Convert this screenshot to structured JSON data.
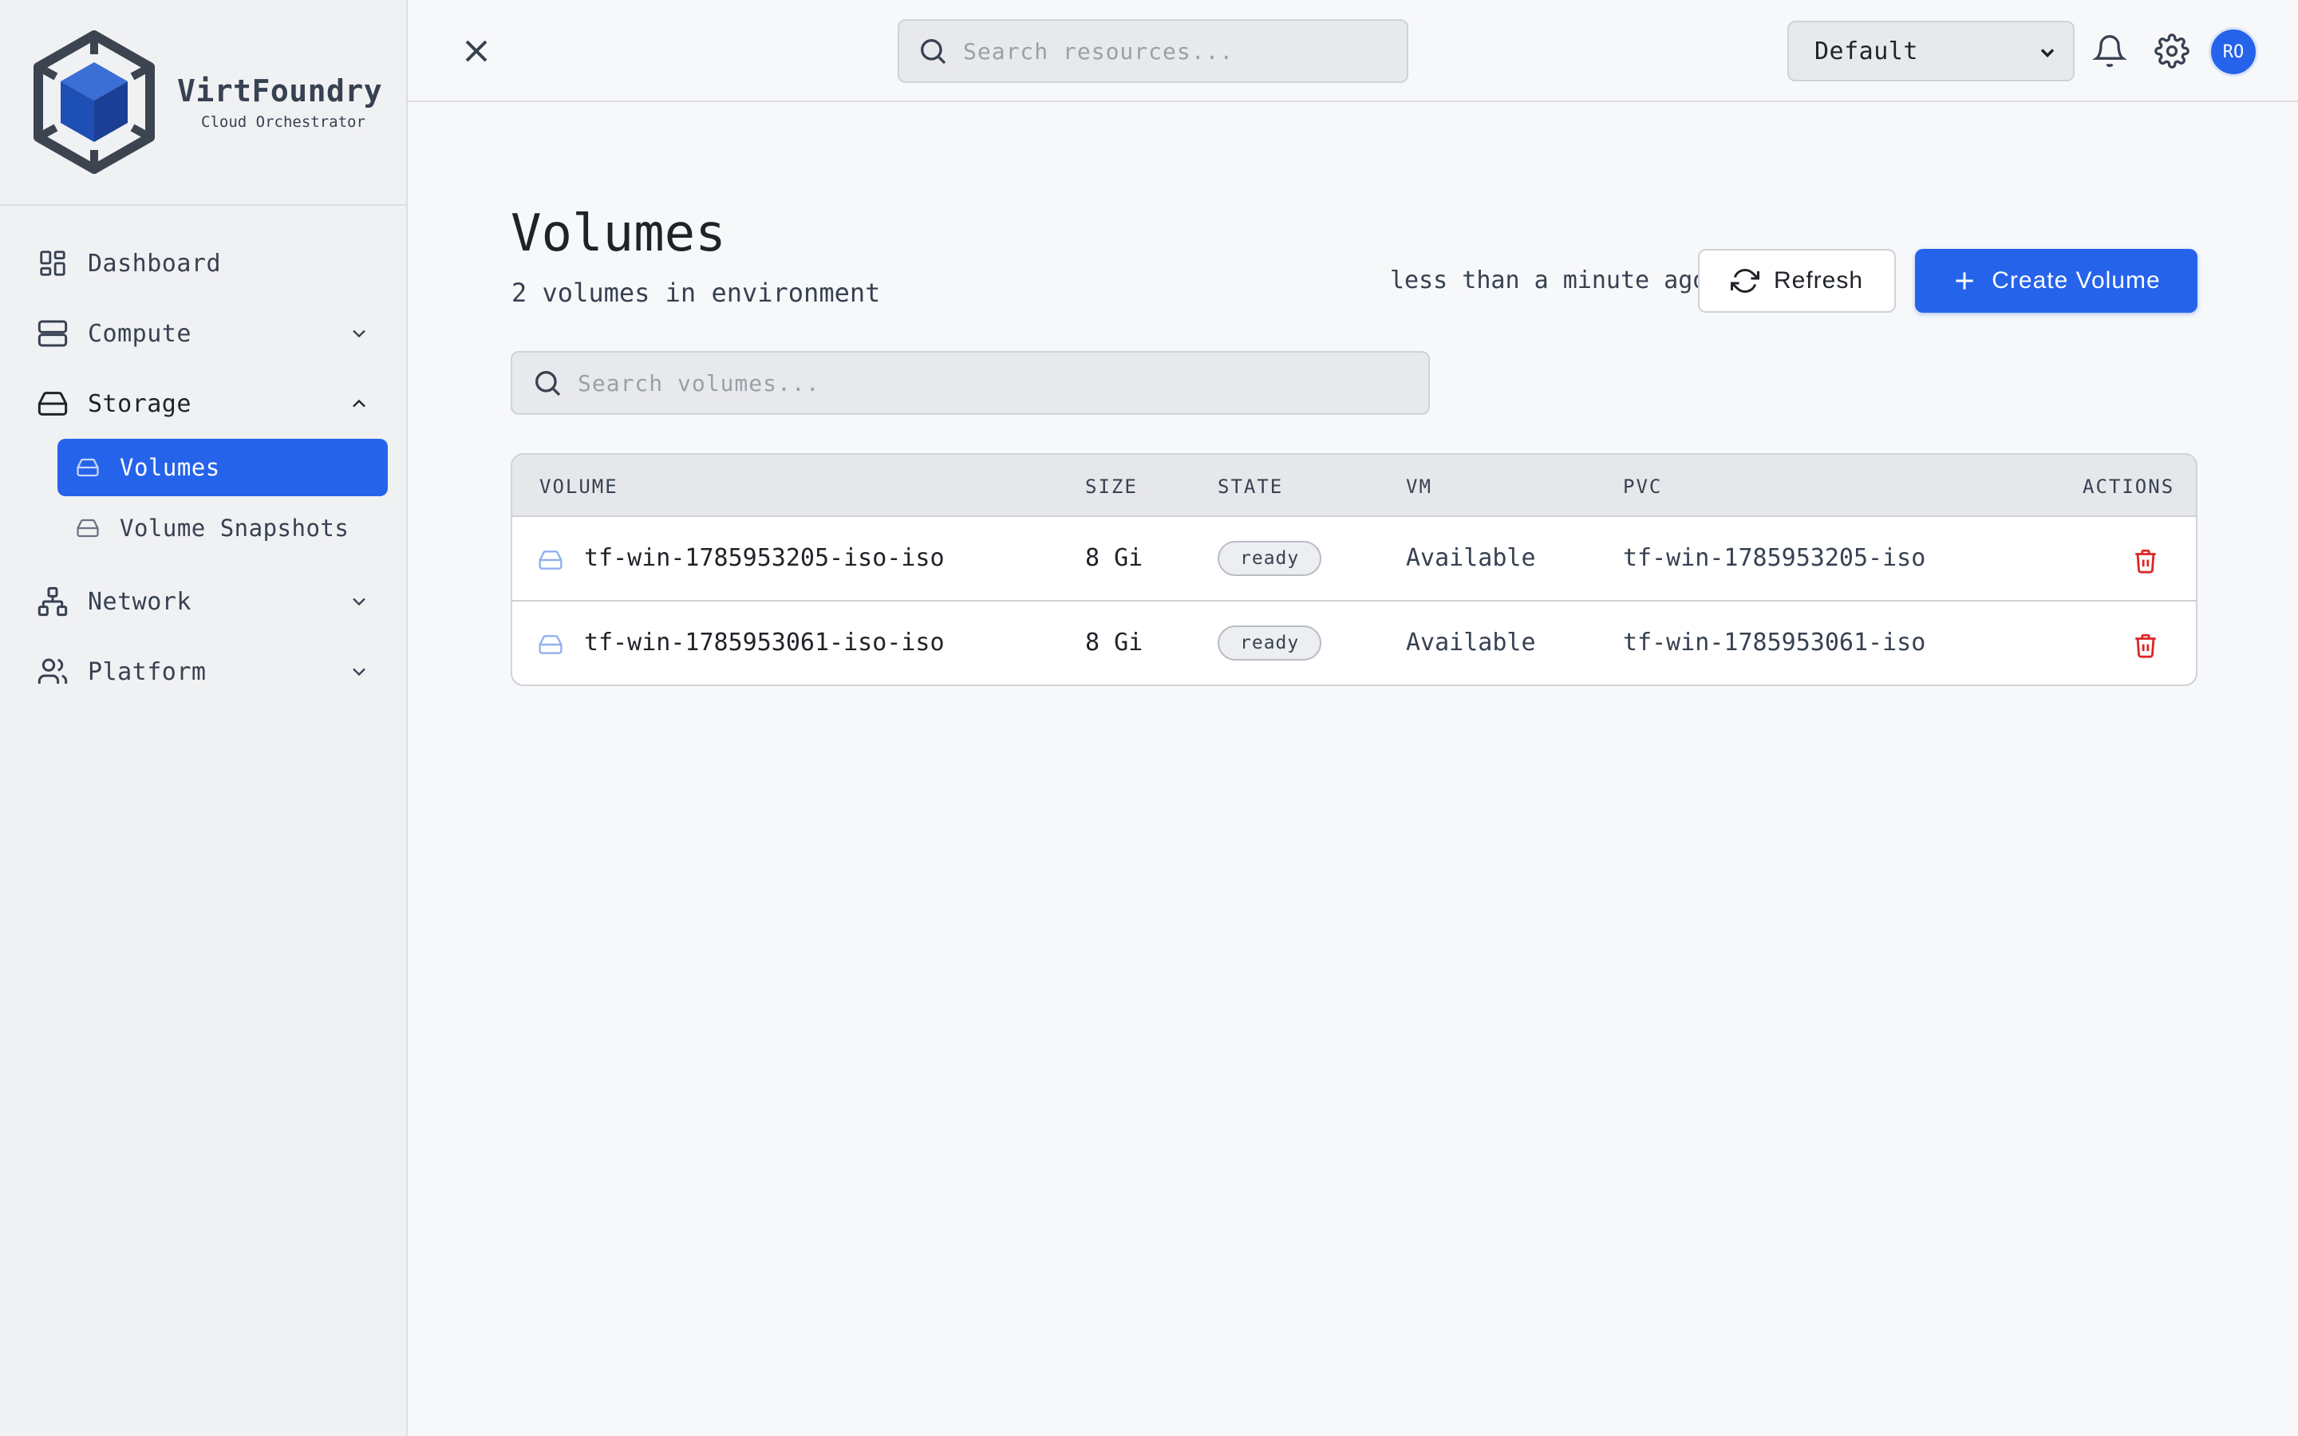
{
  "brand": {
    "name": "VirtFoundry",
    "subtitle": "Cloud Orchestrator"
  },
  "sidebar": {
    "items": [
      {
        "label": "Dashboard",
        "icon": "dashboard-grid-icon"
      },
      {
        "label": "Compute",
        "icon": "server-icon",
        "expanded": false
      },
      {
        "label": "Storage",
        "icon": "drive-icon",
        "expanded": true,
        "children": [
          {
            "label": "Volumes",
            "icon": "drive-icon",
            "active": true
          },
          {
            "label": "Volume Snapshots",
            "icon": "drive-icon",
            "active": false
          }
        ]
      },
      {
        "label": "Network",
        "icon": "network-icon",
        "expanded": false
      },
      {
        "label": "Platform",
        "icon": "users-icon",
        "expanded": false
      }
    ]
  },
  "topbar": {
    "search_placeholder": "Search resources...",
    "environment": "Default",
    "avatar_initials": "RO"
  },
  "page": {
    "title": "Volumes",
    "subtitle": "2 volumes in environment",
    "updated": "less than a minute ago",
    "refresh_label": "Refresh",
    "create_label": "Create Volume",
    "search_placeholder": "Search volumes..."
  },
  "table": {
    "columns": [
      "VOLUME",
      "SIZE",
      "STATE",
      "VM",
      "PVC",
      "ACTIONS"
    ],
    "rows": [
      {
        "volume": "tf-win-1785953205-iso-iso",
        "size": "8 Gi",
        "state": "ready",
        "vm": "Available",
        "pvc": "tf-win-1785953205-iso"
      },
      {
        "volume": "tf-win-1785953061-iso-iso",
        "size": "8 Gi",
        "state": "ready",
        "vm": "Available",
        "pvc": "tf-win-1785953061-iso"
      }
    ]
  },
  "colors": {
    "accent": "#2563eb",
    "danger": "#dc2626",
    "sidebar_bg": "#f0f1f3"
  }
}
